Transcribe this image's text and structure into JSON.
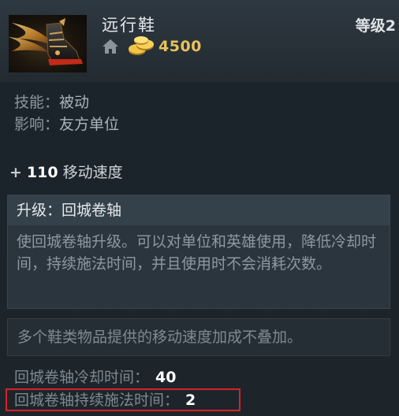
{
  "item": {
    "name": "远行鞋",
    "cost": "4500",
    "level_label": "等级2"
  },
  "ability": {
    "type_label": "技能：",
    "type_value": "被动",
    "affects_label": "影响：",
    "affects_value": "友方单位"
  },
  "stat": {
    "plus": "+",
    "value": "110",
    "name": "移动速度"
  },
  "upgrade": {
    "title": "升级：回城卷轴",
    "description": "使回城卷轴升级。可以对单位和英雄使用，降低冷却时间，持续施法时间，并且使用时不会消耗次数。"
  },
  "note": "多个鞋类物品提供的移动速度加成不叠加。",
  "attributes": [
    {
      "label": "回城卷轴冷却时间：",
      "value": "40"
    },
    {
      "label": "回城卷轴持续施法时间：",
      "value": "2"
    }
  ],
  "icons": {
    "home": "home-icon",
    "gold": "gold-coins-icon",
    "item": "boots-of-travel-icon"
  },
  "colors": {
    "gold": "#e8c25a",
    "highlight": "#d6222a"
  }
}
